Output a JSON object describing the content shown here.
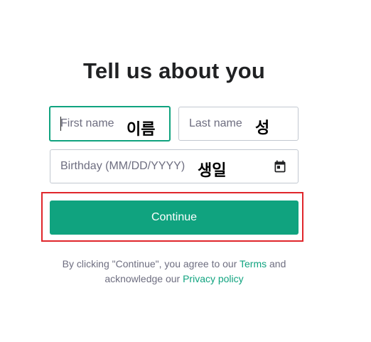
{
  "header": {
    "title": "Tell us about you"
  },
  "form": {
    "first_name": {
      "placeholder": "First name",
      "annotation": "이름"
    },
    "last_name": {
      "placeholder": "Last name",
      "annotation": "성"
    },
    "birthday": {
      "placeholder": "Birthday (MM/DD/YYYY)",
      "annotation": "생일",
      "icon": "calendar-icon"
    },
    "continue_label": "Continue"
  },
  "footer": {
    "line1_prefix": "By clicking \"Continue\", you agree to our ",
    "terms_link": "Terms",
    "line1_suffix": " and",
    "line2_prefix": "acknowledge our ",
    "privacy_link": "Privacy policy"
  },
  "colors": {
    "accent": "#10a37f",
    "highlight": "#e0262b",
    "text": "#202123",
    "muted": "#6e6e80"
  }
}
